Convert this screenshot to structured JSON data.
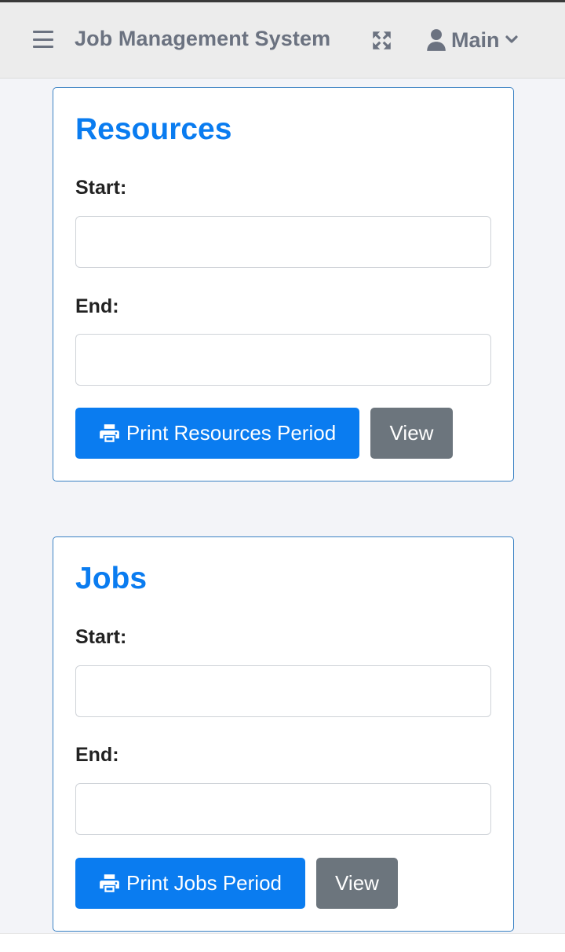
{
  "header": {
    "app_title": "Job Management System",
    "menu_icon": "hamburger-menu-icon",
    "expand_icon": "fullscreen-expand-icon",
    "user_icon": "user-icon",
    "user_label": "Main",
    "user_chevron_icon": "chevron-down-icon"
  },
  "resources": {
    "title": "Resources",
    "start_label": "Start:",
    "start_value": "",
    "end_label": "End:",
    "end_value": "",
    "print_label": "Print Resources Period",
    "print_icon": "printer-icon",
    "view_label": "View"
  },
  "jobs": {
    "title": "Jobs",
    "start_label": "Start:",
    "start_value": "",
    "end_label": "End:",
    "end_value": "",
    "print_label": "Print Jobs Period",
    "print_icon": "printer-icon",
    "view_label": "View"
  },
  "colors": {
    "primary": "#0a7cf0",
    "secondary": "#6c757d",
    "card_border": "#3b82c4",
    "header_text": "#6b7280"
  }
}
